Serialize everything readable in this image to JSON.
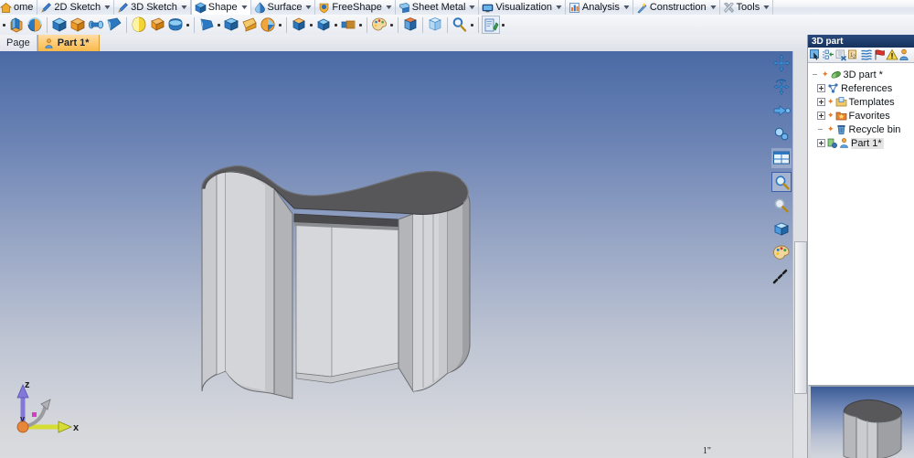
{
  "app": {
    "menubar": {
      "tabs": [
        {
          "label": "ome",
          "icon": "home-icon",
          "truncated": true,
          "dropdown": false
        },
        {
          "label": "2D Sketch",
          "icon": "pencil-blue-icon",
          "dropdown": true
        },
        {
          "label": "3D Sketch",
          "icon": "pencil-blue-icon",
          "dropdown": true
        },
        {
          "label": "Shape",
          "icon": "cube-blue-icon",
          "dropdown": true,
          "active": true
        },
        {
          "label": "Surface",
          "icon": "surface-drop-icon",
          "dropdown": true
        },
        {
          "label": "FreeShape",
          "icon": "freeshape-shield-icon",
          "dropdown": true
        },
        {
          "label": "Sheet Metal",
          "icon": "sheetmetal-fold-icon",
          "dropdown": true
        },
        {
          "label": "Visualization",
          "icon": "monitor-icon",
          "dropdown": true
        },
        {
          "label": "Analysis",
          "icon": "chart-bars-icon",
          "dropdown": true
        },
        {
          "label": "Construction",
          "icon": "construction-wand-icon",
          "dropdown": true
        },
        {
          "label": "Tools",
          "icon": "tools-wrench-icon",
          "dropdown": true
        }
      ]
    },
    "toolbar": {
      "items": [
        {
          "type": "dot",
          "name": "overflow-dot-left"
        },
        {
          "type": "button",
          "name": "extrude-boss-icon"
        },
        {
          "type": "button",
          "name": "revolve-boss-icon"
        },
        {
          "type": "sep"
        },
        {
          "type": "button",
          "name": "extrude-cut-icon"
        },
        {
          "type": "button",
          "name": "revolve-cut-icon"
        },
        {
          "type": "button",
          "name": "sweep-icon"
        },
        {
          "type": "button",
          "name": "loft-icon"
        },
        {
          "type": "sep"
        },
        {
          "type": "button",
          "name": "fillet-icon"
        },
        {
          "type": "button",
          "name": "chamfer-icon"
        },
        {
          "type": "button",
          "name": "shell-icon"
        },
        {
          "type": "dot",
          "name": "shell-dropdown"
        },
        {
          "type": "sep"
        },
        {
          "type": "button",
          "name": "draft-icon"
        },
        {
          "type": "dot",
          "name": "draft-dropdown"
        },
        {
          "type": "button",
          "name": "pattern-icon"
        },
        {
          "type": "button",
          "name": "mirror-icon"
        },
        {
          "type": "button",
          "name": "rib-icon"
        },
        {
          "type": "dot",
          "name": "rib-dropdown"
        },
        {
          "type": "sep"
        },
        {
          "type": "button",
          "name": "boolean-icon"
        },
        {
          "type": "dot",
          "name": "boolean-dropdown"
        },
        {
          "type": "button",
          "name": "split-icon"
        },
        {
          "type": "dot",
          "name": "split-dropdown"
        },
        {
          "type": "button",
          "name": "thread-icon"
        },
        {
          "type": "dot",
          "name": "thread-dropdown"
        },
        {
          "type": "sep"
        },
        {
          "type": "button",
          "name": "material-palette-icon"
        },
        {
          "type": "dot",
          "name": "material-dropdown"
        },
        {
          "type": "sep"
        },
        {
          "type": "button",
          "name": "solid-box-icon"
        },
        {
          "type": "sep"
        },
        {
          "type": "button",
          "name": "transparent-box-icon"
        },
        {
          "type": "sep"
        },
        {
          "type": "button",
          "name": "measure-icon"
        },
        {
          "type": "dot",
          "name": "measure-dropdown"
        },
        {
          "type": "sep"
        },
        {
          "type": "button",
          "name": "config-icon"
        },
        {
          "type": "dot",
          "name": "config-dropdown"
        }
      ]
    },
    "pagerow": {
      "page_label": "Page",
      "tab": {
        "label": "Part 1*",
        "icon": "part-person-icon"
      },
      "controls": [
        {
          "name": "panel-dropdown-icon",
          "glyph": "▼"
        },
        {
          "name": "panel-close-icon",
          "glyph": "✕"
        }
      ]
    },
    "viewport": {
      "view_tools": [
        {
          "name": "pan-icon",
          "dropdown": false,
          "selected": false
        },
        {
          "name": "rotate-icon",
          "dropdown": true,
          "selected": false
        },
        {
          "name": "view-orientation-icon",
          "dropdown": true,
          "selected": false
        },
        {
          "name": "zoom-fit-icon",
          "dropdown": false,
          "selected": false
        },
        {
          "name": "view-layout-icon",
          "dropdown": true,
          "selected": false
        },
        {
          "name": "zoom-window-icon",
          "dropdown": false,
          "selected": true
        },
        {
          "name": "zoom-icon",
          "dropdown": false,
          "selected": false
        },
        {
          "name": "render-mode-icon",
          "dropdown": false,
          "selected": false
        },
        {
          "name": "color-palette-icon",
          "dropdown": false,
          "selected": false
        },
        {
          "name": "section-line-icon",
          "dropdown": false,
          "selected": false
        }
      ],
      "scale_label": "1\"",
      "axes": [
        {
          "label": "z",
          "color": "#7b6fd4"
        },
        {
          "label": "y",
          "color": "#8e8e8e"
        },
        {
          "label": "x",
          "color": "#cdd431"
        }
      ],
      "background": {
        "top": "#4a6aa5",
        "bottom": "#dadbde"
      },
      "model": {
        "name": "curved-shell-part",
        "top_face_color": "#57575a",
        "side_light_color": "#d2d3d6",
        "side_mid_color": "#b9babe",
        "side_dark_color": "#9b9ca0"
      }
    },
    "dock": {
      "title": "3D part",
      "toolbar": [
        {
          "name": "select-mode-icon"
        },
        {
          "name": "expand-tree-icon"
        },
        {
          "name": "collapse-tree-icon"
        },
        {
          "name": "rename-icon"
        },
        {
          "name": "filter-icon"
        },
        {
          "name": "flag-icon"
        },
        {
          "name": "warning-icon"
        },
        {
          "name": "properties-icon"
        }
      ],
      "tree": [
        {
          "label": "3D part *",
          "icon": "part-doc-icon",
          "indent": 0,
          "expander": "none",
          "marker": true
        },
        {
          "label": "References",
          "icon": "references-icon",
          "indent": 1,
          "expander": "plus",
          "marker": false
        },
        {
          "label": "Templates",
          "icon": "templates-folder-icon",
          "indent": 1,
          "expander": "plus",
          "marker": true
        },
        {
          "label": "Favorites",
          "icon": "favorites-folder-icon",
          "indent": 1,
          "expander": "plus",
          "marker": true
        },
        {
          "label": "Recycle bin",
          "icon": "recycle-bin-icon",
          "indent": 1,
          "expander": "none",
          "marker": true
        },
        {
          "label": "Part 1*",
          "icon": "part-person-icon",
          "indent": 1,
          "expander": "plus",
          "marker": false,
          "selected": true
        }
      ]
    },
    "preview": {
      "name": "model-thumbnail-preview"
    }
  }
}
